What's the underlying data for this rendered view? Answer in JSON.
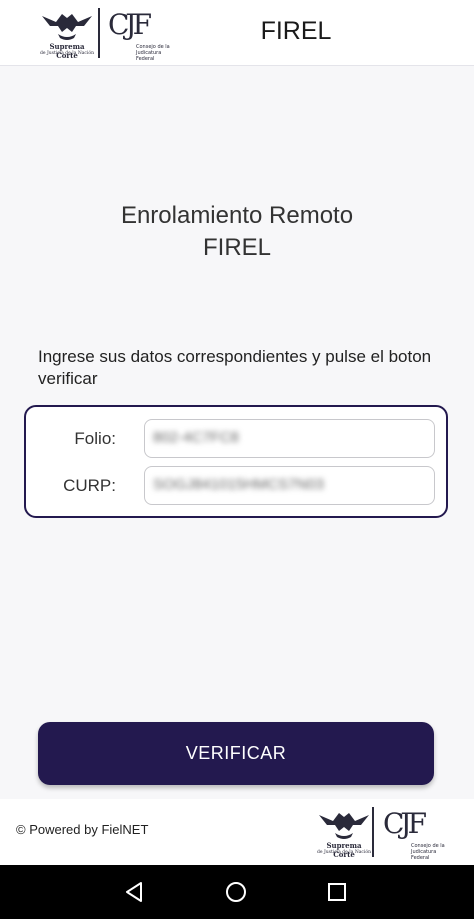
{
  "header": {
    "scjn_logo": {
      "line1": "Suprema Corte",
      "line2": "de Justicia de la Nación"
    },
    "cjf_logo": {
      "mark": "CJF",
      "sub": "Consejo de la Judicatura Federal"
    },
    "title": "FIREL"
  },
  "main": {
    "title_line1": "Enrolamiento Remoto",
    "title_line2": "FIREL",
    "instructions": "Ingrese sus datos correspondientes y pulse el boton verificar"
  },
  "form": {
    "folio": {
      "label": "Folio:",
      "value": "802-4C7FC8"
    },
    "curp": {
      "label": "CURP:",
      "value": "SOGJ841015HMCS7N03"
    }
  },
  "actions": {
    "verify_label": "VERIFICAR"
  },
  "footer": {
    "powered_by": "© Powered by FielNET",
    "scjn_logo": {
      "line1": "Suprema Corte",
      "line2": "de Justicia de la Nación"
    },
    "cjf_logo": {
      "mark": "CJF",
      "sub": "Consejo de la Judicatura Federal"
    }
  },
  "navigation": {
    "icons": [
      "back-icon",
      "home-icon",
      "recents-icon"
    ]
  },
  "colors": {
    "primary": "#23194f",
    "background": "#f7f7f9",
    "text": "#222222"
  }
}
